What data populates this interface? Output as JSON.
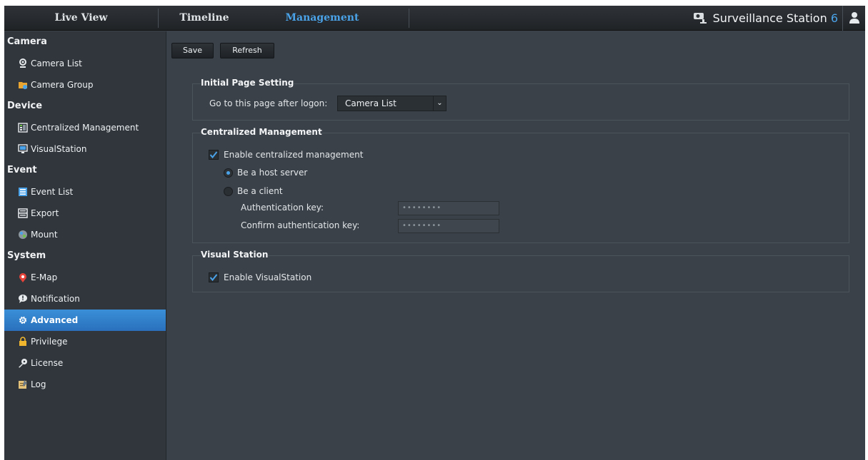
{
  "topbar": {
    "tabs": [
      {
        "label": "Live View"
      },
      {
        "label": "Timeline"
      },
      {
        "label": "Management"
      }
    ],
    "brand": "Surveillance Station",
    "brand_version": "6"
  },
  "sidebar": {
    "sections": [
      {
        "label": "Camera",
        "items": [
          {
            "label": "Camera List",
            "icon": "camera-icon"
          },
          {
            "label": "Camera Group",
            "icon": "folder-icon"
          }
        ]
      },
      {
        "label": "Device",
        "items": [
          {
            "label": "Centralized Management",
            "icon": "centralized-icon"
          },
          {
            "label": "VisualStation",
            "icon": "monitor-icon"
          }
        ]
      },
      {
        "label": "Event",
        "items": [
          {
            "label": "Event List",
            "icon": "list-icon"
          },
          {
            "label": "Export",
            "icon": "export-icon"
          },
          {
            "label": "Mount",
            "icon": "mount-icon"
          }
        ]
      },
      {
        "label": "System",
        "items": [
          {
            "label": "E-Map",
            "icon": "map-pin-icon"
          },
          {
            "label": "Notification",
            "icon": "notification-icon"
          },
          {
            "label": "Advanced",
            "icon": "gear-icon",
            "selected": true
          },
          {
            "label": "Privilege",
            "icon": "lock-icon"
          },
          {
            "label": "License",
            "icon": "key-icon"
          },
          {
            "label": "Log",
            "icon": "log-icon"
          }
        ]
      }
    ]
  },
  "toolbar": {
    "save_label": "Save",
    "refresh_label": "Refresh"
  },
  "initial_page": {
    "legend": "Initial Page Setting",
    "label": "Go to this page after logon:",
    "selected": "Camera List"
  },
  "centralized": {
    "legend": "Centralized Management",
    "enable_label": "Enable centralized management",
    "enable_checked": true,
    "host_label": "Be a host server",
    "client_label": "Be a client",
    "auth_key_label": "Authentication key:",
    "auth_key_value": "••••••••",
    "confirm_key_label": "Confirm authentication key:",
    "confirm_key_value": "••••••••"
  },
  "visual_station": {
    "legend": "Visual Station",
    "enable_label": "Enable VisualStation",
    "enable_checked": true
  },
  "colors": {
    "accent": "#4aa3e8",
    "background": "#3a4148",
    "sidebar": "#30363c"
  }
}
